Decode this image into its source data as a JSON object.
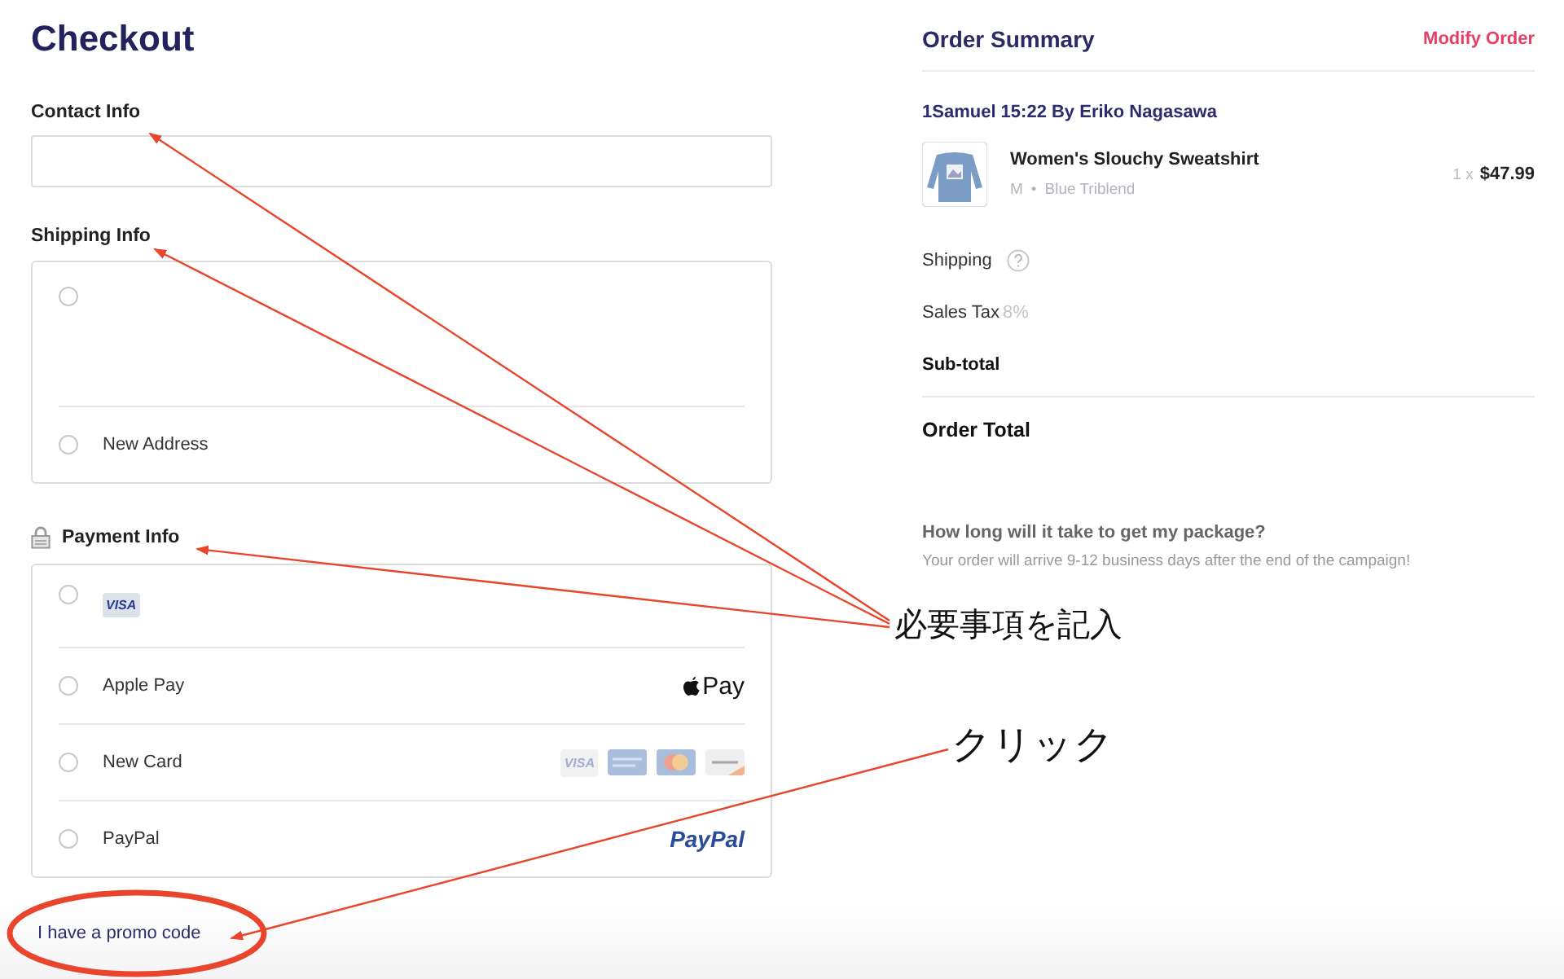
{
  "checkout": {
    "title": "Checkout",
    "contact": {
      "label": "Contact Info"
    },
    "shipping": {
      "label": "Shipping Info",
      "options": [
        {
          "selected": false
        },
        {
          "label": "New Address",
          "selected": false
        }
      ]
    },
    "payment": {
      "label": "Payment Info",
      "options": [
        {
          "selected": false,
          "logos": [
            {
              "kind": "visa",
              "text": "VISA"
            }
          ]
        },
        {
          "label": "Apple Pay",
          "selected": false,
          "brand": {
            "kind": "applepay",
            "text": "Pay"
          }
        },
        {
          "label": "New Card",
          "selected": false,
          "logos": [
            {
              "kind": "visa",
              "text": "VISA"
            },
            {
              "kind": "amex"
            },
            {
              "kind": "mastercard"
            },
            {
              "kind": "discover"
            }
          ]
        },
        {
          "label": "PayPal",
          "selected": false,
          "brand": {
            "kind": "paypal",
            "text": "PayPal"
          }
        }
      ]
    },
    "promo_link": "I have a promo code"
  },
  "summary": {
    "title": "Order Summary",
    "modify": "Modify Order",
    "campaign": "1Samuel 15:22 By Eriko Nagasawa",
    "item": {
      "name": "Women's Slouchy Sweatshirt",
      "size": "M",
      "separator": "•",
      "style": "Blue Triblend",
      "qty": "1 x",
      "price": "$47.99"
    },
    "shipping": "Shipping",
    "tax": "Sales Tax",
    "tax_rate": "8%",
    "subtotal": "Sub-total",
    "total": "Order Total",
    "faq_question": "How long will it take to get my package?",
    "faq_answer": "Your order will arrive 9-12 business days after the end of the campaign!"
  },
  "annotations": [
    {
      "text": "必要事項を記入"
    },
    {
      "text": "クリック"
    }
  ]
}
